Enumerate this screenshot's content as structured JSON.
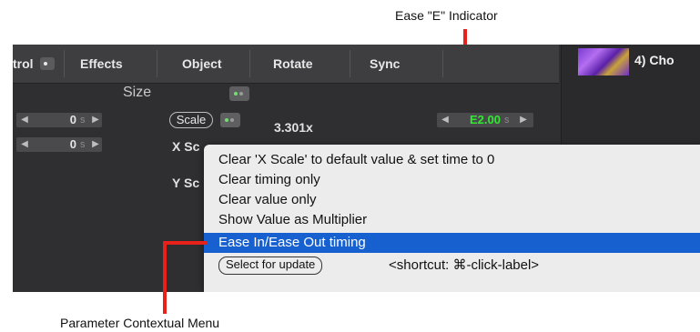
{
  "annotations": {
    "ease_indicator": "Ease \"E\" Indicator",
    "context_menu": "Parameter Contextual Menu"
  },
  "tabs": [
    {
      "label": "trol"
    },
    {
      "label": "Effects"
    },
    {
      "label": "Object"
    },
    {
      "label": "Rotate"
    },
    {
      "label": "Sync"
    }
  ],
  "thumbnail_label": "4) Cho",
  "size_label": "Size",
  "rows": {
    "row1": {
      "value": "0",
      "unit": "s"
    },
    "row2": {
      "value": "0",
      "unit": "s"
    }
  },
  "scale_button": "Scale",
  "scale_value": "3.301x",
  "ease_stepper": {
    "value": "E2.00",
    "unit": "s"
  },
  "x_scale_label": "X Sc",
  "y_scale_label": "Y Sc",
  "menu": {
    "items": [
      "Clear 'X Scale' to default value & set time to 0",
      "Clear timing only",
      "Clear value only",
      "Show Value as Multiplier",
      "Ease In/Ease Out timing"
    ],
    "selected": "Ease In/Ease Out timing",
    "select_button": "Select for update",
    "shortcut": "<shortcut: ⌘-click-label>"
  },
  "colors": {
    "annotation_red": "#e8211a",
    "selection_blue": "#1760d0",
    "ease_green": "#2fea2f"
  }
}
